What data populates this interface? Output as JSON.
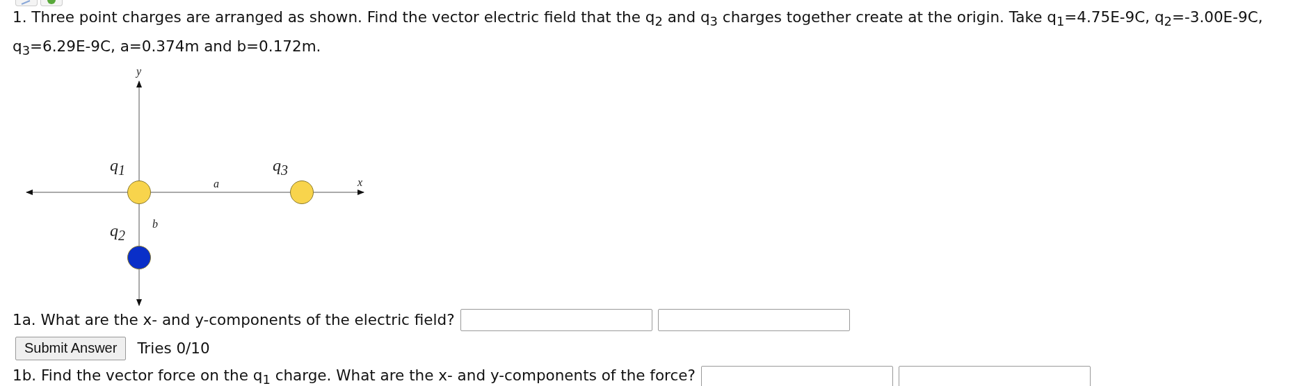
{
  "toolbar": {
    "icons": [
      {
        "kind": "pencil"
      },
      {
        "kind": "globe"
      }
    ]
  },
  "problem": {
    "text": "1. Three point charges are arranged as shown. Find the vector electric field that the q$_{2}$ and q$_{3}$ charges together create at the origin. Take q$_{1}$=4.75E-9C, q$_{2}$=-3.00E-9C, q$_{3}$=6.29E-9C, a=0.374m and b=0.172m."
  },
  "diagram": {
    "x_axis_label": "x",
    "y_axis_label": "y",
    "distance_a_label": "a",
    "distance_b_label": "b",
    "charges": [
      {
        "label": "q$_{1}$",
        "color": "#f8d44c"
      },
      {
        "label": "q$_{3}$",
        "color": "#f8d44c"
      },
      {
        "label": "q$_{2}$",
        "color": "#0a2fc8"
      }
    ]
  },
  "parts": [
    {
      "question": "1a. What are the x- and y-components of the electric field?",
      "fields": [
        {
          "kind": "input"
        },
        {
          "kind": "input"
        }
      ],
      "submit_label": "Submit Answer",
      "tries": "Tries 0/10"
    },
    {
      "question": "1b. Find the vector force on the q$_{1}$ charge. What are the x- and y-components of the force?",
      "fields": [
        {
          "kind": "input"
        },
        {
          "kind": "input"
        }
      ]
    }
  ]
}
